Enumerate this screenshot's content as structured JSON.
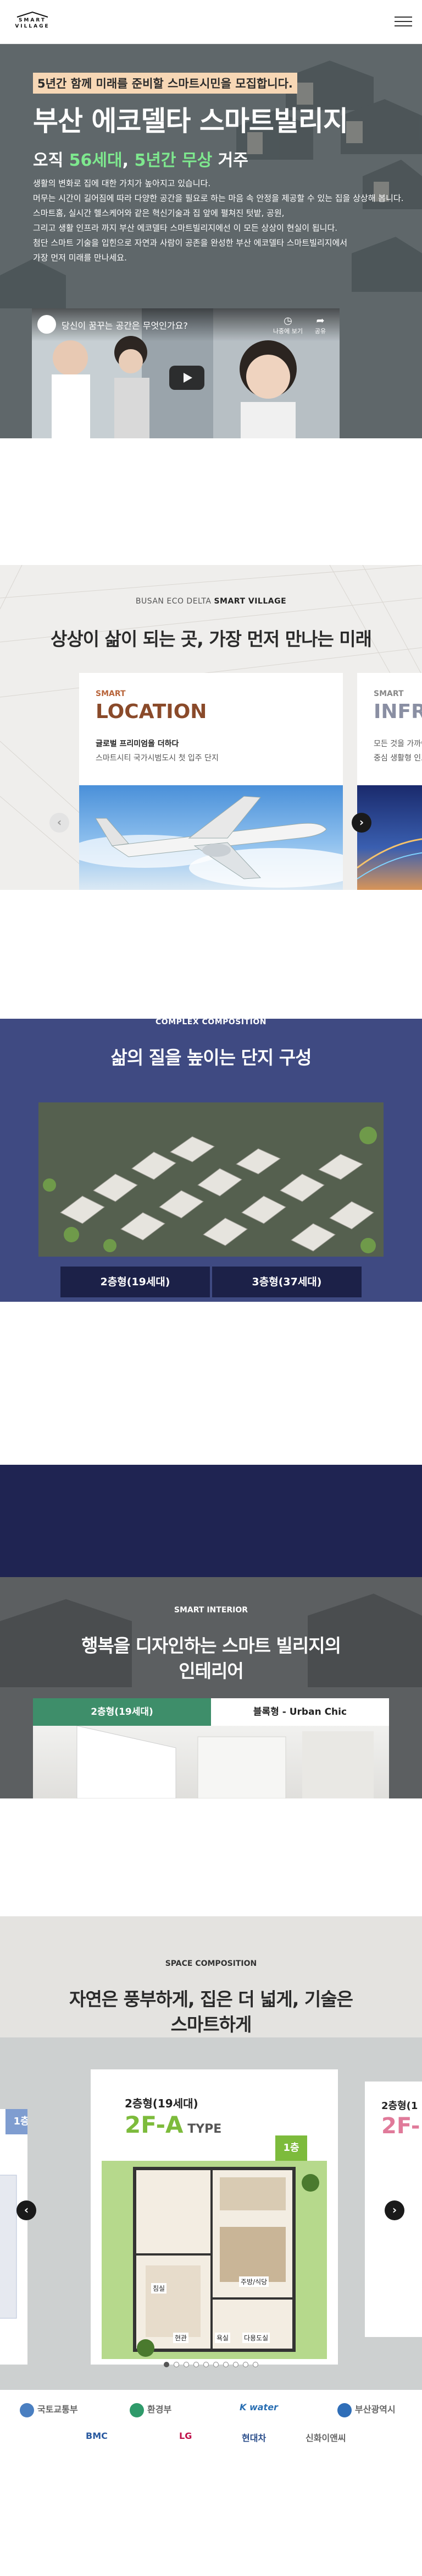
{
  "header": {
    "logo_line1": "SMART",
    "logo_line2": "VILLAGE",
    "menu_icon": "hamburger-icon"
  },
  "hero": {
    "badge": "5년간 함께 미래를 준비할 스마트시민을 모집합니다.",
    "title": "부산 에코델타 스마트빌리지",
    "sub_prefix": "오직 ",
    "sub_hl1": "56세대",
    "sub_mid": ", ",
    "sub_hl2": "5년간 무상",
    "sub_suffix": " 거주",
    "desc": [
      "생활의 변화로 집에 대한 가치가 높아지고 있습니다.",
      "머무는 시간이 길어짐에 따라 다양한 공간을 필요로 하는 마음 속 안정을 제공할 수 있는 집을 상상해 봅니다.",
      "스마트홈, 실시간 헬스케어와 같은 혁신기술과 집 앞에 펼쳐진 텃밭, 공원,",
      "그리고 생활 인프라 까지 부산 에코델타 스마트빌리지에선 이 모든 상상이 현실이 됩니다.",
      "첨단 스마트 기술을 입힌으로 자연과 사람이 공존을 완성한 부산 에코델타 스마트빌리지에서",
      "가장 먼저 미래를 만나세요."
    ],
    "video": {
      "title": "당신이 꿈꾸는 공간은 무엇인가요?",
      "later_label": "나중에 보기",
      "share_label": "공유"
    }
  },
  "vision": {
    "eyebrow_prefix": "BUSAN ECO DELTA ",
    "eyebrow_bold": "SMART VILLAGE",
    "title": "상상이 삶이 되는 곳, 가장 먼저 만나는 미래",
    "cards": [
      {
        "kicker": "SMART",
        "head": "LOCATION",
        "line1": "글로벌 프리미엄을 더하다",
        "line2": "스마트시티 국가시범도시 첫 입주 단지"
      },
      {
        "kicker": "SMART",
        "head": "INFRA",
        "line1": "",
        "line2": "모든 것을 가까이",
        "line3": "중심 생활형 인프라"
      }
    ],
    "prev_label": "‹",
    "next_label": "›"
  },
  "complex": {
    "eyebrow": "COMPLEX COMPOSITION",
    "title": "삶의 질을 높이는 단지 구성",
    "buttons": [
      "2층형(19세대)",
      "3층형(37세대)"
    ]
  },
  "interior": {
    "eyebrow": "SMART INTERIOR",
    "title_line1": "행복을 디자인하는 스마트 빌리지의",
    "title_line2": "인테리어",
    "tabs": [
      "2층형(19세대)",
      "블록형 - Urban Chic"
    ]
  },
  "space": {
    "eyebrow": "SPACE COMPOSITION",
    "title_line1": "자연은 풍부하게, 집은 더 넓게, 기술은",
    "title_line2": "스마트하게",
    "plan": {
      "kicker": "2층형(19세대)",
      "type": "2F-A",
      "type_suffix": " TYPE",
      "floor": "1층",
      "rooms": [
        "침실",
        "주방/식당",
        "현관",
        "욕실",
        "다용도실"
      ]
    },
    "left_floor": "1층",
    "right_kicker": "2층형(1",
    "right_type": "2F-",
    "slides_total": 10,
    "slide_active": 1
  },
  "partners": [
    "국토교통부",
    "환경부",
    "K water",
    "부산광역시",
    "BMC",
    "LG",
    "현대차",
    "신화이앤씨"
  ],
  "colors": {
    "navy": "#3f4a82",
    "dark_navy": "#1f2452",
    "green": "#7dbb3c",
    "green_tab": "#3e8e6a",
    "accent_brown": "#8a4a2a",
    "highlight": "#7ee88e"
  }
}
